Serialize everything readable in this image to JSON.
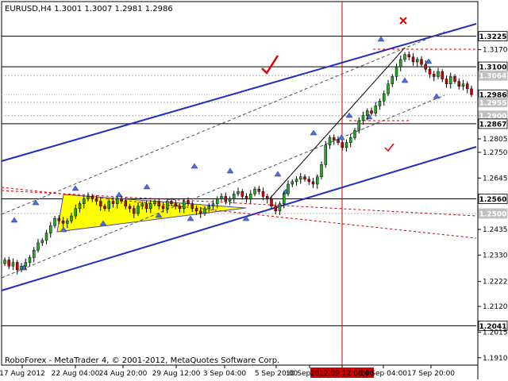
{
  "chart_data": {
    "type": "candlestick",
    "title": "EURUSD,H4  1.3001 1.3007 1.2981 1.2986",
    "symbol": "EURUSD",
    "timeframe": "H4",
    "ohlc_last": {
      "open": 1.3001,
      "high": 1.3007,
      "low": 1.2981,
      "close": 1.2986
    },
    "copyright": "RoboForex - MetaTrader 4, © 2001-2012, MetaQuotes Software Corp.",
    "ylim": [
      1.188,
      1.336
    ],
    "y_ticks": [
      "1.3225",
      "1.3170",
      "1.3100",
      "1.3064",
      "1.2986",
      "1.2955",
      "1.2900",
      "1.2867",
      "1.2805",
      "1.2750",
      "1.2645",
      "1.2560",
      "1.2500",
      "1.2435",
      "1.2330",
      "1.2222",
      "1.2120",
      "1.2041",
      "1.2015",
      "1.1910"
    ],
    "x_ticks": [
      "17 Aug 2012",
      "22 Aug 04:00",
      "24 Aug 20:00",
      "29 Aug 12:00",
      "3 Sep 04:00",
      "5 Sep 20:00",
      "10 Sep 12:00",
      "2012.09.12 08:00",
      "14 Sep 04:00",
      "17 Sep 20:00"
    ],
    "vertical_marker_label": "2012.09.12 08:00",
    "levels": [
      {
        "price": 1.3225,
        "label": "1.3225",
        "style": "solid"
      },
      {
        "price": 1.31,
        "label": "1.3100",
        "style": "solid"
      },
      {
        "price": 1.3064,
        "label": "1.3064",
        "style": "dotted"
      },
      {
        "price": 1.2986,
        "label": "1.2986",
        "style": "current"
      },
      {
        "price": 1.2955,
        "label": "1.2955",
        "style": "dotted"
      },
      {
        "price": 1.29,
        "label": "1.2900",
        "style": "dotted"
      },
      {
        "price": 1.2867,
        "label": "1.2867",
        "style": "solid"
      },
      {
        "price": 1.256,
        "label": "1.2560",
        "style": "solid"
      },
      {
        "price": 1.25,
        "label": "1.2500",
        "style": "dotted"
      },
      {
        "price": 1.2041,
        "label": "1.2041",
        "style": "solid"
      }
    ],
    "close_series": [
      1.231,
      1.2285,
      1.23,
      1.227,
      1.2285,
      1.23,
      1.232,
      1.235,
      1.238,
      1.239,
      1.242,
      1.245,
      1.248,
      1.247,
      1.246,
      1.247,
      1.249,
      1.252,
      1.254,
      1.256,
      1.257,
      1.256,
      1.255,
      1.253,
      1.252,
      1.255,
      1.254,
      1.256,
      1.255,
      1.253,
      1.252,
      1.25,
      1.253,
      1.254,
      1.252,
      1.254,
      1.255,
      1.253,
      1.252,
      1.255,
      1.254,
      1.253,
      1.252,
      1.255,
      1.254,
      1.252,
      1.251,
      1.25,
      1.252,
      1.253,
      1.254,
      1.256,
      1.257,
      1.255,
      1.256,
      1.258,
      1.259,
      1.257,
      1.256,
      1.258,
      1.26,
      1.259,
      1.257,
      1.256,
      1.253,
      1.251,
      1.254,
      1.258,
      1.262,
      1.263,
      1.264,
      1.265,
      1.264,
      1.263,
      1.262,
      1.265,
      1.27,
      1.278,
      1.281,
      1.28,
      1.279,
      1.277,
      1.279,
      1.281,
      1.284,
      1.288,
      1.29,
      1.292,
      1.291,
      1.294,
      1.296,
      1.299,
      1.303,
      1.306,
      1.31,
      1.313,
      1.315,
      1.314,
      1.312,
      1.313,
      1.311,
      1.309,
      1.307,
      1.306,
      1.308,
      1.305,
      1.303,
      1.306,
      1.304,
      1.302,
      1.303,
      1.301,
      1.2986
    ]
  }
}
